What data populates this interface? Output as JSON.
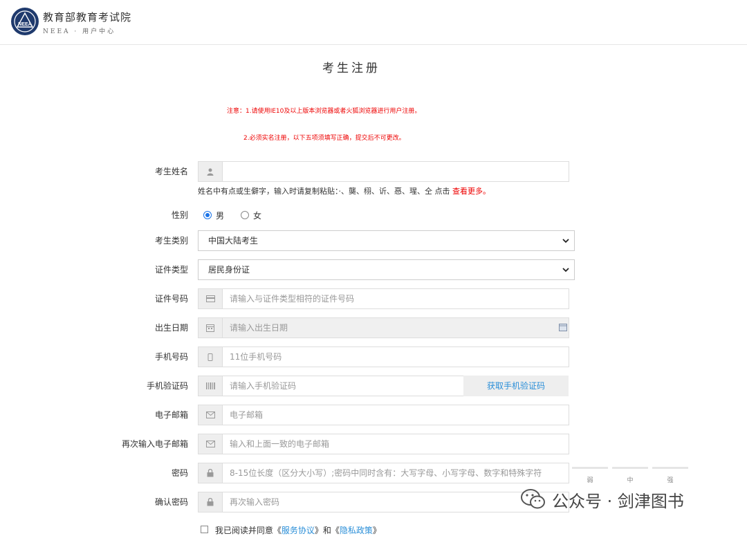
{
  "header": {
    "brand_cn": "教育部教育考试院",
    "brand_en": "NEEA · 用户中心",
    "logo_text": "NEEA"
  },
  "page_title": "考生注册",
  "notices": [
    "注意：1.请使用IE10及以上版本浏览器或者火狐浏览器进行用户注册。",
    "2.必须实名注册，以下五项须填写正确，提交后不可更改。"
  ],
  "form": {
    "name": {
      "label": "考生姓名",
      "value": ""
    },
    "name_hint": "姓名中有点或生僻字，输入时请复制粘贴：·、龑、栩、䜣、㥑、瑆、仝 点击",
    "name_hint_link": "查看更多。",
    "gender": {
      "label": "性别",
      "options": [
        "男",
        "女"
      ],
      "selected": "男"
    },
    "candidate_type": {
      "label": "考生类别",
      "value": "中国大陆考生"
    },
    "id_type": {
      "label": "证件类型",
      "value": "居民身份证"
    },
    "id_number": {
      "label": "证件号码",
      "placeholder": "请输入与证件类型相符的证件号码"
    },
    "birth_date": {
      "label": "出生日期",
      "placeholder": "请输入出生日期"
    },
    "mobile": {
      "label": "手机号码",
      "placeholder": "11位手机号码"
    },
    "sms_code": {
      "label": "手机验证码",
      "placeholder": "请输入手机验证码",
      "button": "获取手机验证码"
    },
    "email": {
      "label": "电子邮箱",
      "placeholder": "电子邮箱"
    },
    "email_confirm": {
      "label": "再次输入电子邮箱",
      "placeholder": "输入和上面一致的电子邮箱"
    },
    "password": {
      "label": "密码",
      "placeholder": "8-15位长度（区分大小写）;密码中同时含有：大写字母、小写字母、数字和特殊字符"
    },
    "password_strength": [
      "弱",
      "中",
      "强"
    ],
    "password_confirm": {
      "label": "确认密码",
      "placeholder": "再次输入密码"
    }
  },
  "terms": {
    "prefix": "我已阅读并同意《",
    "link1": "服务协议",
    "middle": "》和《",
    "link2": "隐私政策",
    "suffix": "》"
  },
  "watermark": "公众号 · 剑津图书",
  "colors": {
    "accent": "#2b8fd8",
    "notice": "#ee0000",
    "radio": "#1a73e8"
  }
}
